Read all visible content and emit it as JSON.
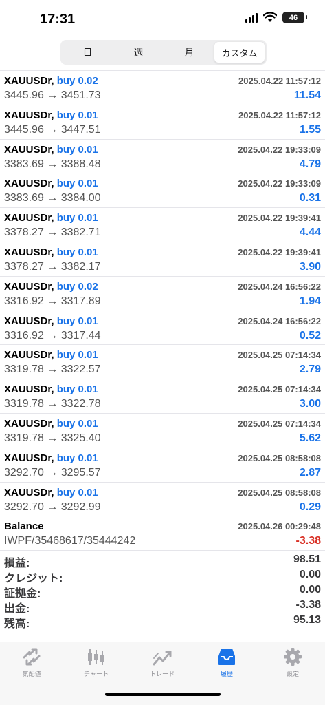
{
  "status_bar": {
    "time": "17:31",
    "battery": "46"
  },
  "period_tabs": [
    {
      "label": "日",
      "active": false
    },
    {
      "label": "週",
      "active": false
    },
    {
      "label": "月",
      "active": false
    },
    {
      "label": "カスタム",
      "active": true
    }
  ],
  "deals": [
    {
      "symbol": "XAUUSDr,",
      "side": "buy 0.02",
      "time": "2025.04.22 11:57:12",
      "prices": "3445.96 → 3451.73",
      "profit": "11.54"
    },
    {
      "symbol": "XAUUSDr,",
      "side": "buy 0.01",
      "time": "2025.04.22 11:57:12",
      "prices": "3445.96 → 3447.51",
      "profit": "1.55"
    },
    {
      "symbol": "XAUUSDr,",
      "side": "buy 0.01",
      "time": "2025.04.22 19:33:09",
      "prices": "3383.69 → 3388.48",
      "profit": "4.79"
    },
    {
      "symbol": "XAUUSDr,",
      "side": "buy 0.01",
      "time": "2025.04.22 19:33:09",
      "prices": "3383.69 → 3384.00",
      "profit": "0.31"
    },
    {
      "symbol": "XAUUSDr,",
      "side": "buy 0.01",
      "time": "2025.04.22 19:39:41",
      "prices": "3378.27 → 3382.71",
      "profit": "4.44"
    },
    {
      "symbol": "XAUUSDr,",
      "side": "buy 0.01",
      "time": "2025.04.22 19:39:41",
      "prices": "3378.27 → 3382.17",
      "profit": "3.90"
    },
    {
      "symbol": "XAUUSDr,",
      "side": "buy 0.02",
      "time": "2025.04.24 16:56:22",
      "prices": "3316.92 → 3317.89",
      "profit": "1.94"
    },
    {
      "symbol": "XAUUSDr,",
      "side": "buy 0.01",
      "time": "2025.04.24 16:56:22",
      "prices": "3316.92 → 3317.44",
      "profit": "0.52"
    },
    {
      "symbol": "XAUUSDr,",
      "side": "buy 0.01",
      "time": "2025.04.25 07:14:34",
      "prices": "3319.78 → 3322.57",
      "profit": "2.79"
    },
    {
      "symbol": "XAUUSDr,",
      "side": "buy 0.01",
      "time": "2025.04.25 07:14:34",
      "prices": "3319.78 → 3322.78",
      "profit": "3.00"
    },
    {
      "symbol": "XAUUSDr,",
      "side": "buy 0.01",
      "time": "2025.04.25 07:14:34",
      "prices": "3319.78 → 3325.40",
      "profit": "5.62"
    },
    {
      "symbol": "XAUUSDr,",
      "side": "buy 0.01",
      "time": "2025.04.25 08:58:08",
      "prices": "3292.70 → 3295.57",
      "profit": "2.87"
    },
    {
      "symbol": "XAUUSDr,",
      "side": "buy 0.01",
      "time": "2025.04.25 08:58:08",
      "prices": "3292.70 → 3292.99",
      "profit": "0.29"
    }
  ],
  "balance_entry": {
    "label": "Balance",
    "time": "2025.04.26 00:29:48",
    "comment": "IWPF/35468617/35444242",
    "amount": "-3.38"
  },
  "summary": [
    {
      "label": "損益:",
      "value": "98.51"
    },
    {
      "label": "クレジット:",
      "value": "0.00"
    },
    {
      "label": "証拠金:",
      "value": "0.00"
    },
    {
      "label": "出金:",
      "value": "-3.38"
    },
    {
      "label": "残高:",
      "value": "95.13"
    }
  ],
  "tabbar": [
    {
      "label": "気配値",
      "icon": "quotes-icon",
      "active": false
    },
    {
      "label": "チャート",
      "icon": "chart-icon",
      "active": false
    },
    {
      "label": "トレード",
      "icon": "trade-icon",
      "active": false
    },
    {
      "label": "履歴",
      "icon": "history-icon",
      "active": true
    },
    {
      "label": "設定",
      "icon": "settings-icon",
      "active": false
    }
  ],
  "colors": {
    "accent": "#1a73e8",
    "negative": "#d93025",
    "muted_icon": "#a8a8ad"
  }
}
